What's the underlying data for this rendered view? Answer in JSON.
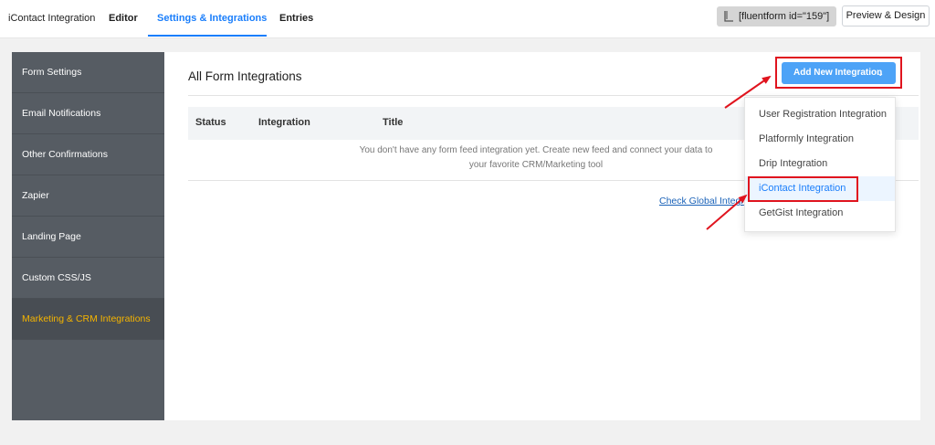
{
  "topbar": {
    "title": "iContact Integration",
    "tabs": [
      "Editor",
      "Settings & Integrations",
      "Entries"
    ],
    "shortcode": "[fluentform id=\"159\"]",
    "preview_label": "Preview & Design"
  },
  "sidebar": {
    "items": [
      {
        "label": "Form Settings"
      },
      {
        "label": "Email Notifications"
      },
      {
        "label": "Other Confirmations"
      },
      {
        "label": "Zapier"
      },
      {
        "label": "Landing Page"
      },
      {
        "label": "Custom CSS/JS"
      },
      {
        "label": "Marketing & CRM Integrations"
      }
    ],
    "active_index": 6
  },
  "main": {
    "title": "All Form Integrations",
    "columns": [
      "Status",
      "Integration",
      "Title"
    ],
    "empty_line_1": "You don't have any form feed integration yet. Create new feed and connect your data to",
    "empty_line_2": "your favorite CRM/Marketing tool",
    "global_link": "Check Global Integr"
  },
  "add_button": {
    "label": "Add New Integration"
  },
  "dropdown": {
    "items": [
      "User Registration Integration",
      "Platformly Integration",
      "Drip Integration",
      "iContact Integration",
      "GetGist Integration"
    ],
    "highlighted": "iContact Integration"
  },
  "colors": {
    "accent": "#1a7efb",
    "sidebar_bg": "#565c63",
    "sidebar_active_text": "#f5b400",
    "annotation_red": "#e0141e"
  },
  "icons": {
    "shortcode_copy": "copy-icon",
    "button_chevron": "chevron-down-icon",
    "annotation": "arrow-icon"
  }
}
